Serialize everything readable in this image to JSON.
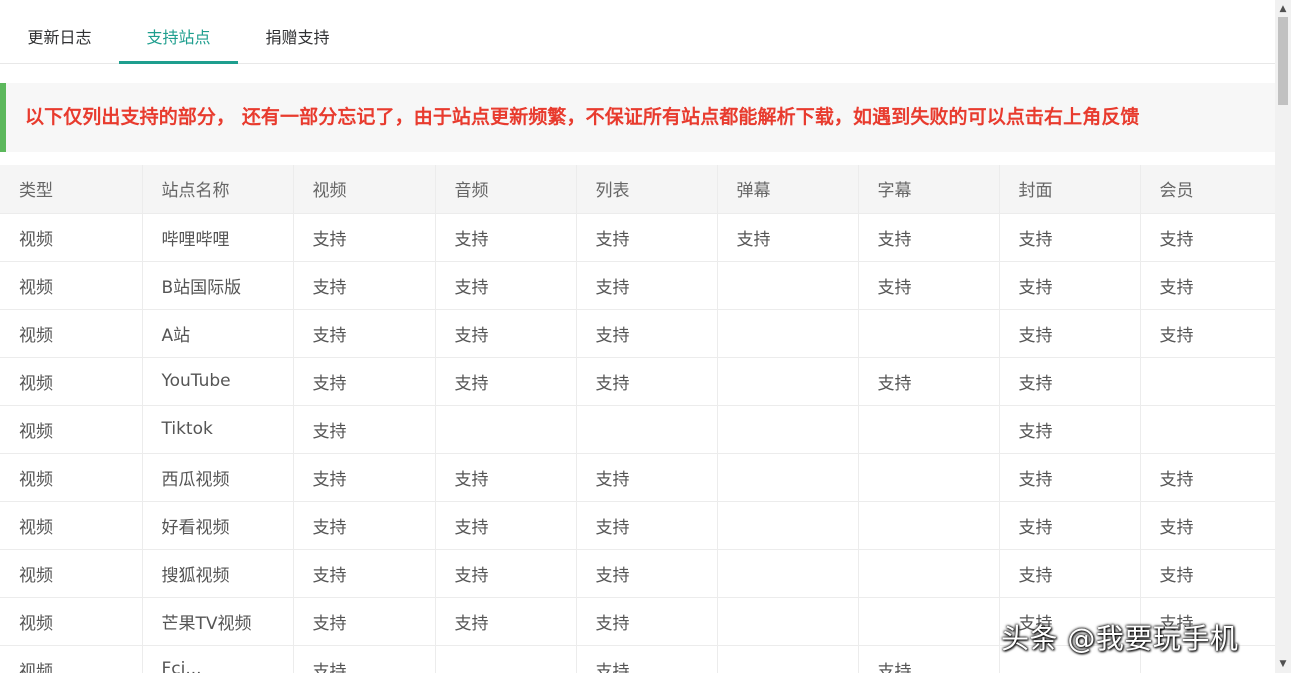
{
  "tabs": [
    {
      "label": "更新日志",
      "active": false
    },
    {
      "label": "支持站点",
      "active": true
    },
    {
      "label": "捐赠支持",
      "active": false
    }
  ],
  "notice": "以下仅列出支持的部分， 还有一部分忘记了，由于站点更新频繁，不保证所有站点都能解析下载，如遇到失败的可以点击右上角反馈",
  "table": {
    "headers": [
      "类型",
      "站点名称",
      "视频",
      "音频",
      "列表",
      "弹幕",
      "字幕",
      "封面",
      "会员"
    ],
    "rows": [
      [
        "视频",
        "哔哩哔哩",
        "支持",
        "支持",
        "支持",
        "支持",
        "支持",
        "支持",
        "支持"
      ],
      [
        "视频",
        "B站国际版",
        "支持",
        "支持",
        "支持",
        "",
        "支持",
        "支持",
        "支持"
      ],
      [
        "视频",
        "A站",
        "支持",
        "支持",
        "支持",
        "",
        "",
        "支持",
        "支持"
      ],
      [
        "视频",
        "YouTube",
        "支持",
        "支持",
        "支持",
        "",
        "支持",
        "支持",
        ""
      ],
      [
        "视频",
        "Tiktok",
        "支持",
        "",
        "",
        "",
        "",
        "支持",
        ""
      ],
      [
        "视频",
        "西瓜视频",
        "支持",
        "支持",
        "支持",
        "",
        "",
        "支持",
        "支持"
      ],
      [
        "视频",
        "好看视频",
        "支持",
        "支持",
        "支持",
        "",
        "",
        "支持",
        "支持"
      ],
      [
        "视频",
        "搜狐视频",
        "支持",
        "支持",
        "支持",
        "",
        "",
        "支持",
        "支持"
      ],
      [
        "视频",
        "芒果TV视频",
        "支持",
        "支持",
        "支持",
        "",
        "",
        "支持",
        "支持"
      ],
      [
        "视频",
        "Fci...",
        "支持",
        "",
        "支持",
        "",
        "支持",
        "",
        ""
      ]
    ]
  },
  "watermark": "头条 @我要玩手机",
  "colors": {
    "accent": "#1e9e8e",
    "notice_text": "#e83b2e",
    "notice_bar": "#5cb85c"
  }
}
